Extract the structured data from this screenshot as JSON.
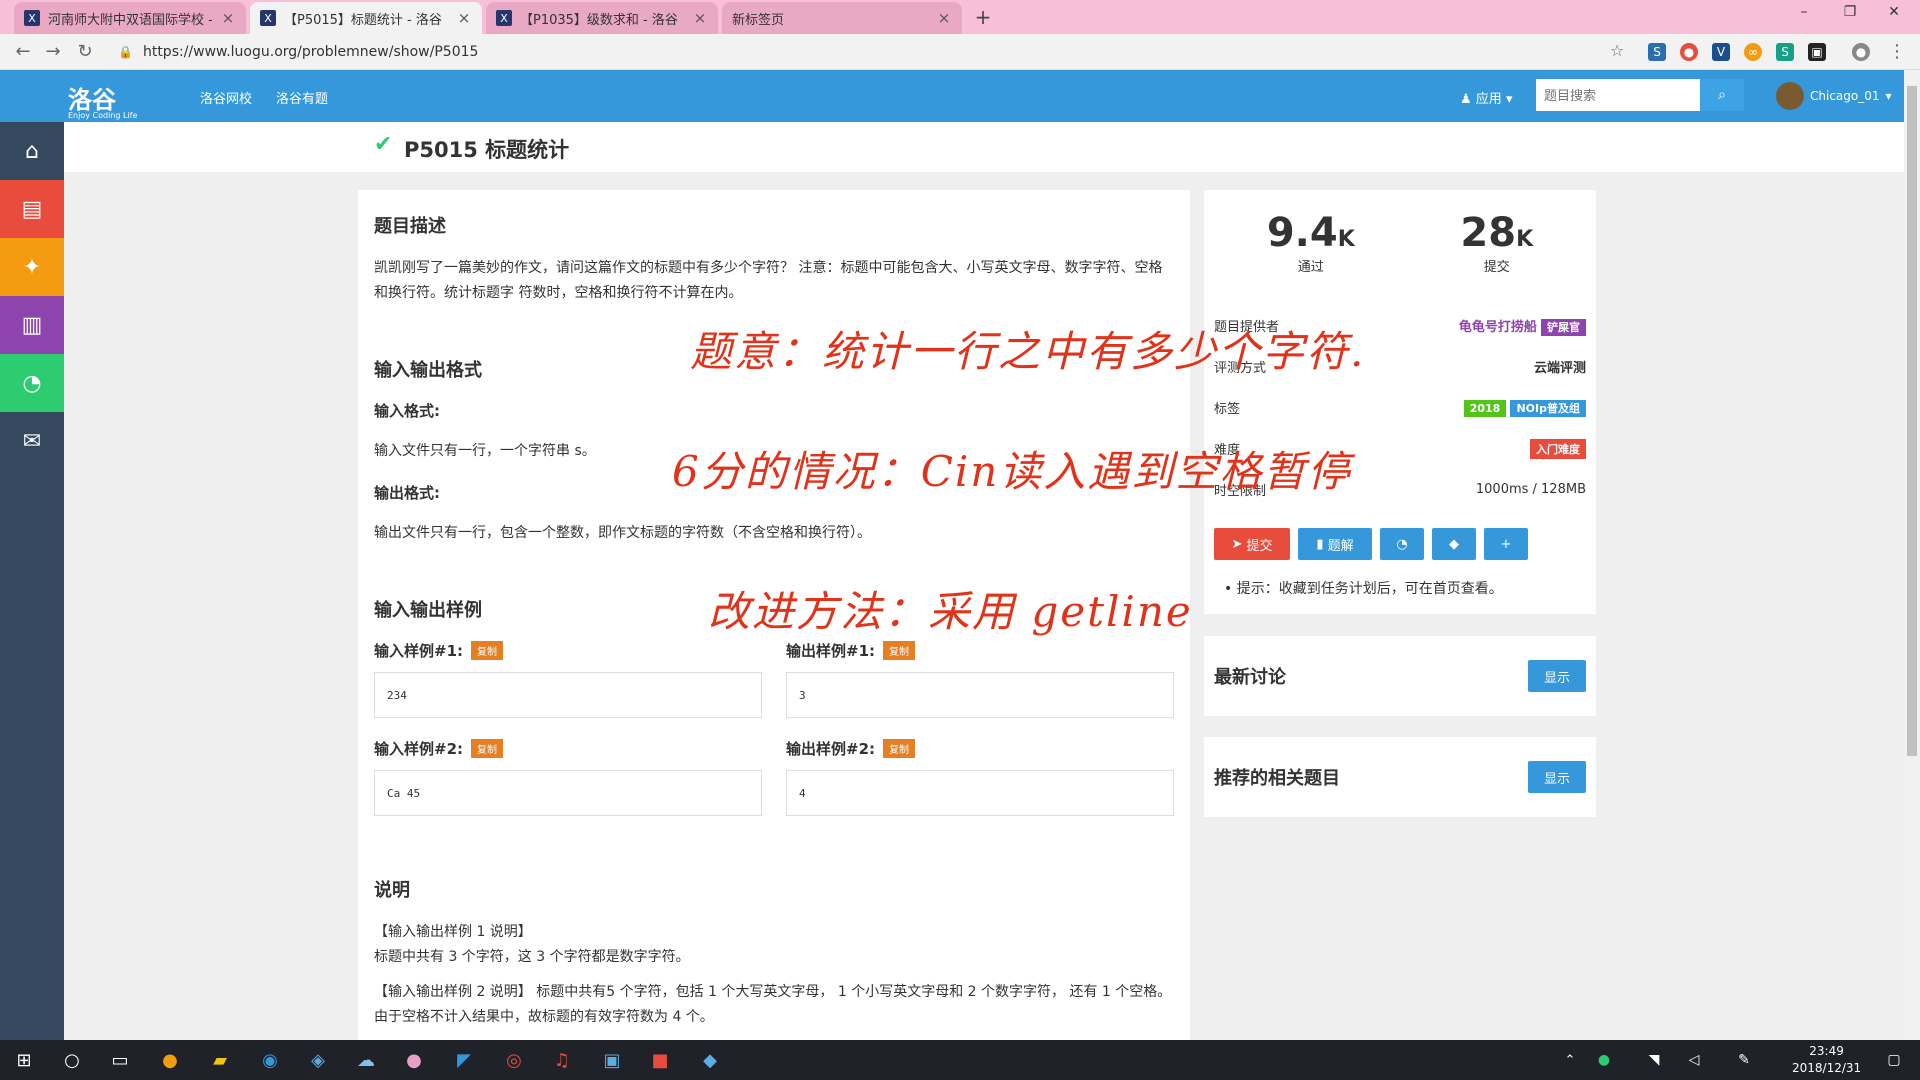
{
  "browser": {
    "tabs": [
      {
        "title": "河南师大附中双语国际学校 - 团队"
      },
      {
        "title": "【P5015】标题统计 - 洛谷"
      },
      {
        "title": "【P1035】级数求和 - 洛谷"
      },
      {
        "title": "新标签页"
      }
    ],
    "url": "https://www.luogu.org/problemnew/show/P5015"
  },
  "header": {
    "logo": "洛谷",
    "logo_sub": "Enjoy Coding Life",
    "nav": [
      "洛谷网校",
      "洛谷有题"
    ],
    "apps": "应用",
    "search_placeholder": "题目搜索",
    "username": "Chicago_01"
  },
  "problem": {
    "title": "P5015 标题统计",
    "desc_heading": "题目描述",
    "desc_text": "凯凯刚写了一篇美妙的作文，请问这篇作文的标题中有多少个字符？ 注意：标题中可能包含大、小写英文字母、数字字符、空格和换行符。统计标题字 符数时，空格和换行符不计算在内。",
    "io_heading": "输入输出格式",
    "input_format_label": "输入格式:",
    "input_format_text": "输入文件只有一行，一个字符串 s。",
    "output_format_label": "输出格式:",
    "output_format_text": "输出文件只有一行，包含一个整数，即作文标题的字符数（不含空格和换行符）。",
    "sample_heading": "输入输出样例",
    "copy_label": "复制",
    "samples": [
      {
        "in_label": "输入样例#1:",
        "in": "234",
        "out_label": "输出样例#1:",
        "out": "3"
      },
      {
        "in_label": "输入样例#2:",
        "in": "Ca 45",
        "out_label": "输出样例#2:",
        "out": "4"
      }
    ],
    "note_heading": "说明",
    "note_1": "【输入输出样例 1 说明】",
    "note_1_text": "标题中共有 3 个字符，这 3 个字符都是数字字符。",
    "note_2": "【输入输出样例 2 说明】 标题中共有5 个字符，包括 1 个大写英文字母， 1 个小写英文字母和 2 个数字字符， 还有 1 个空格。由于空格不计入结果中，故标题的有效字符数为 4 个。"
  },
  "info": {
    "passed": "9.4",
    "passed_unit": "K",
    "passed_label": "通过",
    "submitted": "28",
    "submitted_unit": "K",
    "submitted_label": "提交",
    "provider_label": "题目提供者",
    "provider": "龟龟号打捞船",
    "provider_badge": "铲屎官",
    "judge_label": "评测方式",
    "judge": "云端评测",
    "tags_label": "标签",
    "tags": [
      "2018",
      "NOIp普及组"
    ],
    "difficulty_label": "难度",
    "difficulty": "入门难度",
    "limit_label": "时空限制",
    "limit": "1000ms / 128MB",
    "submit_btn": "提交",
    "solution_btn": "题解",
    "tip": "提示：收藏到任务计划后，可在首页查看。"
  },
  "discussion": {
    "title": "最新讨论",
    "btn": "显示"
  },
  "related": {
    "title": "推荐的相关题目",
    "btn": "显示"
  },
  "handwriting": {
    "line1": "题意：统计一行之中有多少个字符.",
    "line2": "6分的情况：Cin读入遇到空格暂停",
    "line3": "改进方法：采用 getline"
  },
  "taskbar": {
    "time": "23:49",
    "date": "2018/12/31"
  },
  "colors": {
    "header_blue": "#3498db",
    "sidebar_dark": "#34495e",
    "submit_red": "#e74c3c",
    "badge_purple": "#8e44ad",
    "badge_green": "#52c41a",
    "badge_blue": "#3498db"
  }
}
